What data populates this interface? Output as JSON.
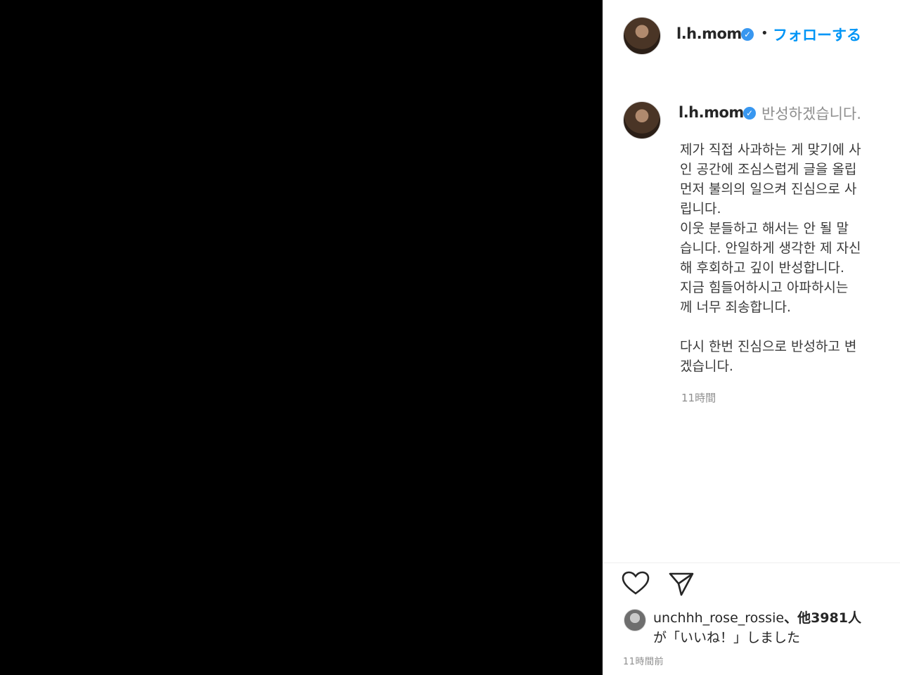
{
  "post": {
    "username": "l.h.mom",
    "follow_label": "フォローする",
    "separator": "•",
    "caption_title": "반성하겠습니다.",
    "caption_lines": [
      "제가 직접 사과하는 게 맞기에 사",
      "인 공간에 조심스럽게 글을 올립",
      "먼저 불의의 일으켜 진심으로 사",
      "립니다.",
      "이웃 분들하고 해서는 안 될 말",
      "습니다. 안일하게 생각한 제 자신",
      "해 후회하고 깊이 반성합니다.",
      "지금 힘들어하시고 아파하시는",
      "께 너무 죄송합니다.",
      "",
      "다시 한번 진심으로 반성하고 변",
      "겠습니다."
    ],
    "caption_age": "11時間",
    "likes": {
      "user": "unchhh_rose_rossie",
      "count_text": "、他3981人",
      "suffix": "が「いいね！」しました"
    },
    "post_time": "11時間前"
  },
  "icons": {
    "like": "heart-icon",
    "share": "share-icon",
    "verified": "verified-badge-icon"
  },
  "colors": {
    "link_blue": "#0095f6",
    "media_bg": "#000000",
    "verified_blue": "#3897f0"
  }
}
